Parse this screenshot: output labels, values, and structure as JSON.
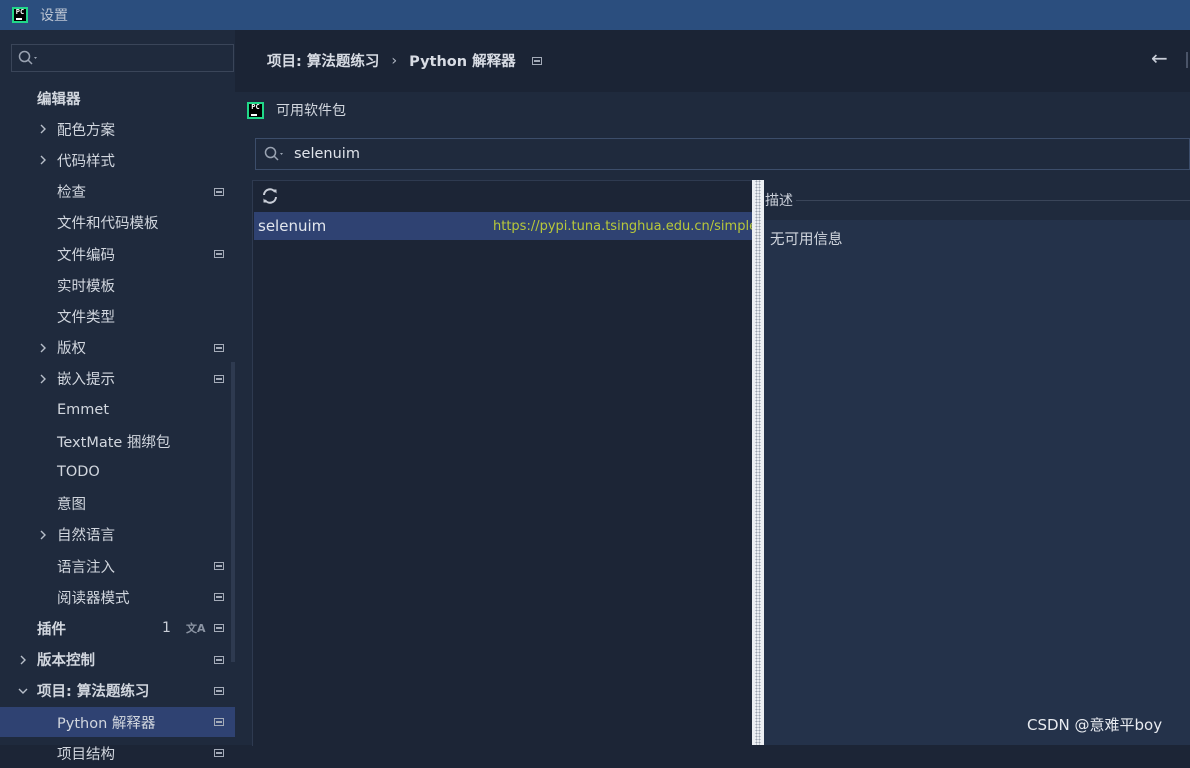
{
  "window": {
    "title": "设置"
  },
  "sidebar": {
    "search_placeholder": "",
    "items": [
      {
        "label": "编辑器",
        "bold": true
      },
      {
        "label": "配色方案",
        "chevron": true
      },
      {
        "label": "代码样式",
        "chevron": true
      },
      {
        "label": "检查",
        "project_icon": true
      },
      {
        "label": "文件和代码模板"
      },
      {
        "label": "文件编码",
        "project_icon": true
      },
      {
        "label": "实时模板"
      },
      {
        "label": "文件类型"
      },
      {
        "label": "版权",
        "chevron": true,
        "project_icon": true
      },
      {
        "label": "嵌入提示",
        "chevron": true,
        "project_icon": true
      },
      {
        "label": "Emmet"
      },
      {
        "label": "TextMate 捆绑包"
      },
      {
        "label": "TODO"
      },
      {
        "label": "意图"
      },
      {
        "label": "自然语言",
        "chevron": true
      },
      {
        "label": "语言注入",
        "project_icon": true
      },
      {
        "label": "阅读器模式",
        "project_icon": true
      },
      {
        "label": "插件",
        "bold": true,
        "badge": "1",
        "translate_icon": true,
        "project_icon": true
      },
      {
        "label": "版本控制",
        "bold": true,
        "chevron": true,
        "project_icon": true
      },
      {
        "label": "项目: 算法题练习",
        "bold": true,
        "chevron": true,
        "expanded": true,
        "project_icon": true
      },
      {
        "label": "Python 解释器",
        "selected": true,
        "project_icon": true
      },
      {
        "label": "项目结构",
        "project_icon": true
      }
    ]
  },
  "breadcrumb": {
    "parent": "项目: 算法题练习",
    "separator": "›",
    "current": "Python 解释器"
  },
  "dialog": {
    "title": "可用软件包",
    "search_value": "selenuim",
    "packages": [
      {
        "name": "selenuim",
        "repo": "https://pypi.tuna.tsinghua.edu.cn/simple"
      }
    ],
    "description_label": "描述",
    "description_text": "无可用信息"
  },
  "watermark": "CSDN @意难平boy",
  "colors": {
    "accent": "#2f4272",
    "titlebar": "#2b4e7e",
    "repo_url": "#b8c83a"
  }
}
